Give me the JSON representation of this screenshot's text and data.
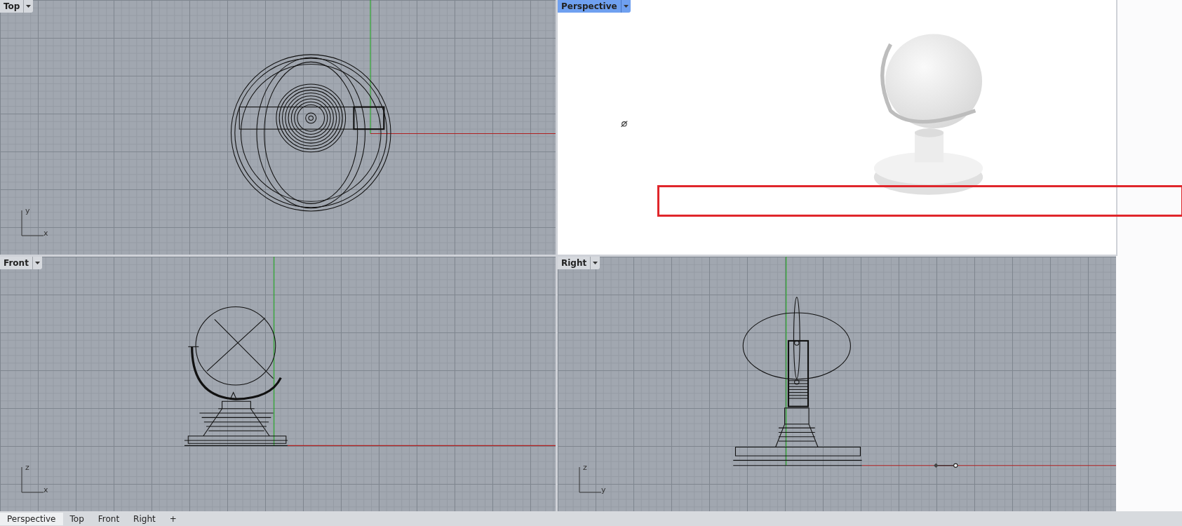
{
  "viewports": [
    {
      "title": "Top",
      "kind": "top",
      "active": false,
      "axes": {
        "vertical": "y",
        "horizontal": "x"
      }
    },
    {
      "title": "Perspective",
      "kind": "perspective",
      "active": true
    },
    {
      "title": "Front",
      "kind": "front",
      "active": false,
      "axes": {
        "vertical": "z",
        "horizontal": "x"
      }
    },
    {
      "title": "Right",
      "kind": "right",
      "active": false,
      "axes": {
        "vertical": "z",
        "horizontal": "y"
      }
    }
  ],
  "tabs": [
    {
      "label": "Perspective",
      "selected": true
    },
    {
      "label": "Top",
      "selected": false
    },
    {
      "label": "Front",
      "selected": false
    },
    {
      "label": "Right",
      "selected": false
    }
  ],
  "add_tab": "+"
}
